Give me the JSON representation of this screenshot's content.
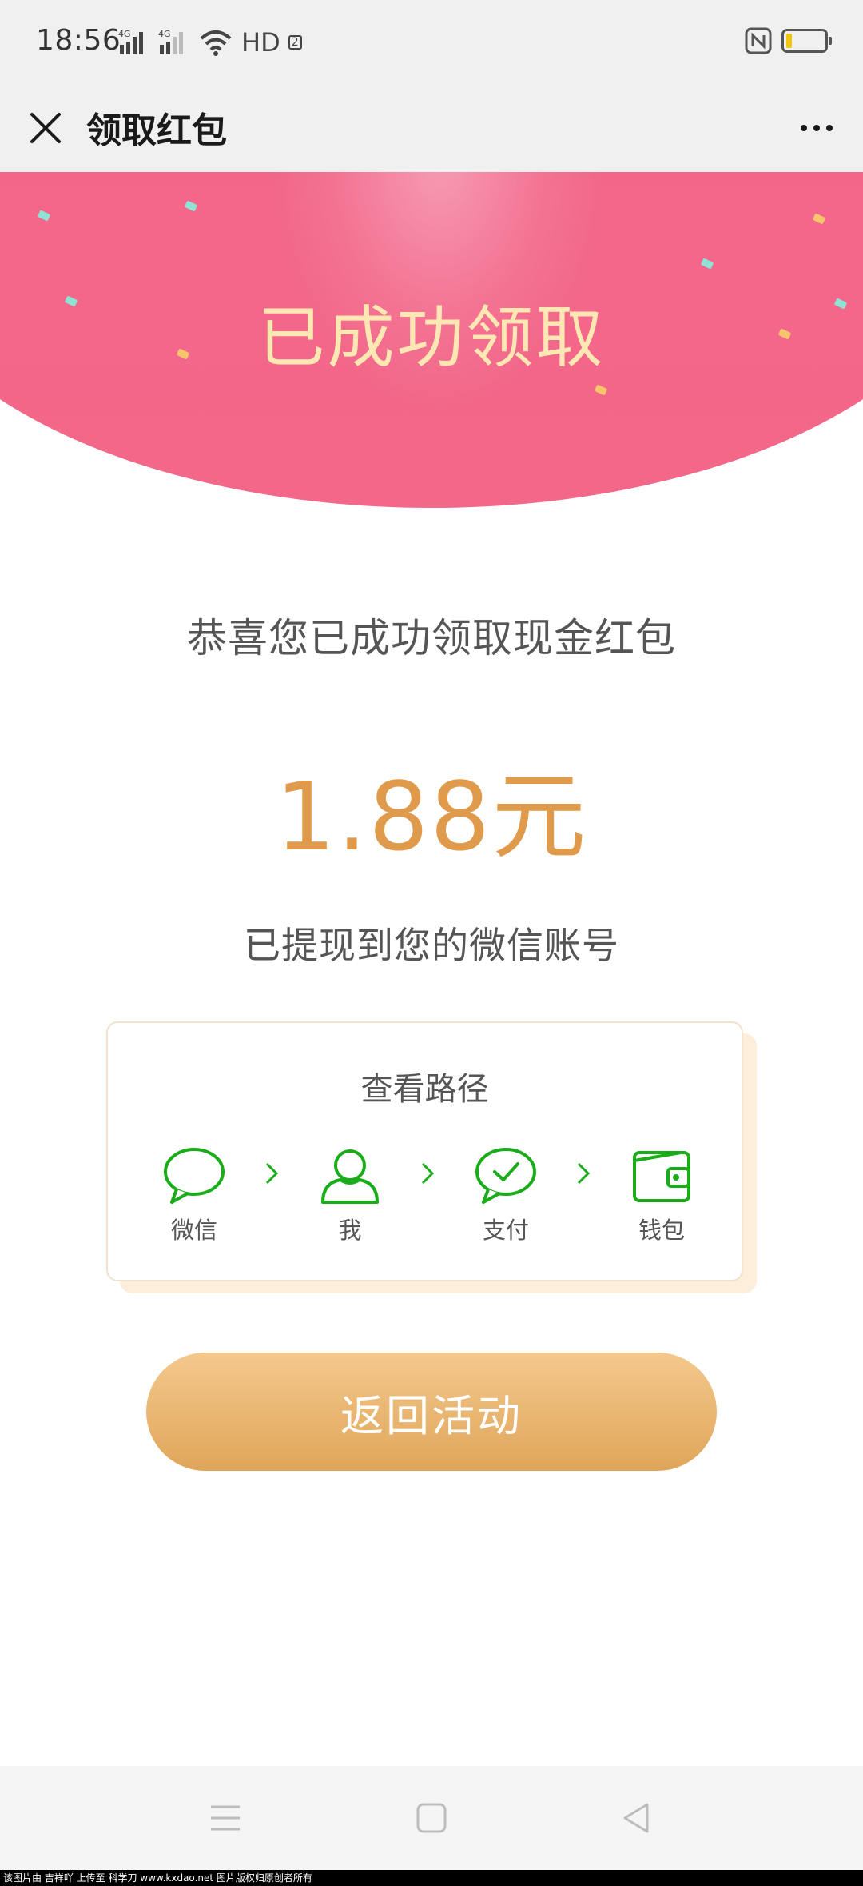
{
  "status_bar": {
    "time": "18:56",
    "network_label_1": "4G",
    "network_label_2": "4G",
    "hd_label": "HD",
    "hd_sub": "2",
    "icons": [
      "signal-4g-icon",
      "signal-4g-icon",
      "wifi-icon",
      "nfc-icon",
      "battery-icon"
    ]
  },
  "title_bar": {
    "title": "领取红包",
    "close_icon": "close-icon",
    "more_icon": "more-icon"
  },
  "hero": {
    "title": "已成功领取"
  },
  "content": {
    "congrats": "恭喜您已成功领取现金红包",
    "amount": "1.88元",
    "withdraw_note": "已提现到您的微信账号"
  },
  "path_card": {
    "title": "查看路径",
    "steps": [
      {
        "label": "微信",
        "icon": "chat-bubble-icon"
      },
      {
        "label": "我",
        "icon": "user-icon"
      },
      {
        "label": "支付",
        "icon": "payment-check-icon"
      },
      {
        "label": "钱包",
        "icon": "wallet-icon"
      }
    ]
  },
  "actions": {
    "back_label": "返回活动"
  },
  "system_nav": {
    "icons": [
      "menu-icon",
      "home-icon",
      "back-icon"
    ]
  },
  "watermark": {
    "text": "该图片由 吉祥吖 上传至 科学刀 www.kxdao.net 图片版权归原创者所有"
  },
  "colors": {
    "hero_pink": "#f35a83",
    "hero_title": "#fde8b3",
    "amount": "#e09a4c",
    "wechat_green": "#1aad19",
    "button_gold": "#e8b46f"
  }
}
